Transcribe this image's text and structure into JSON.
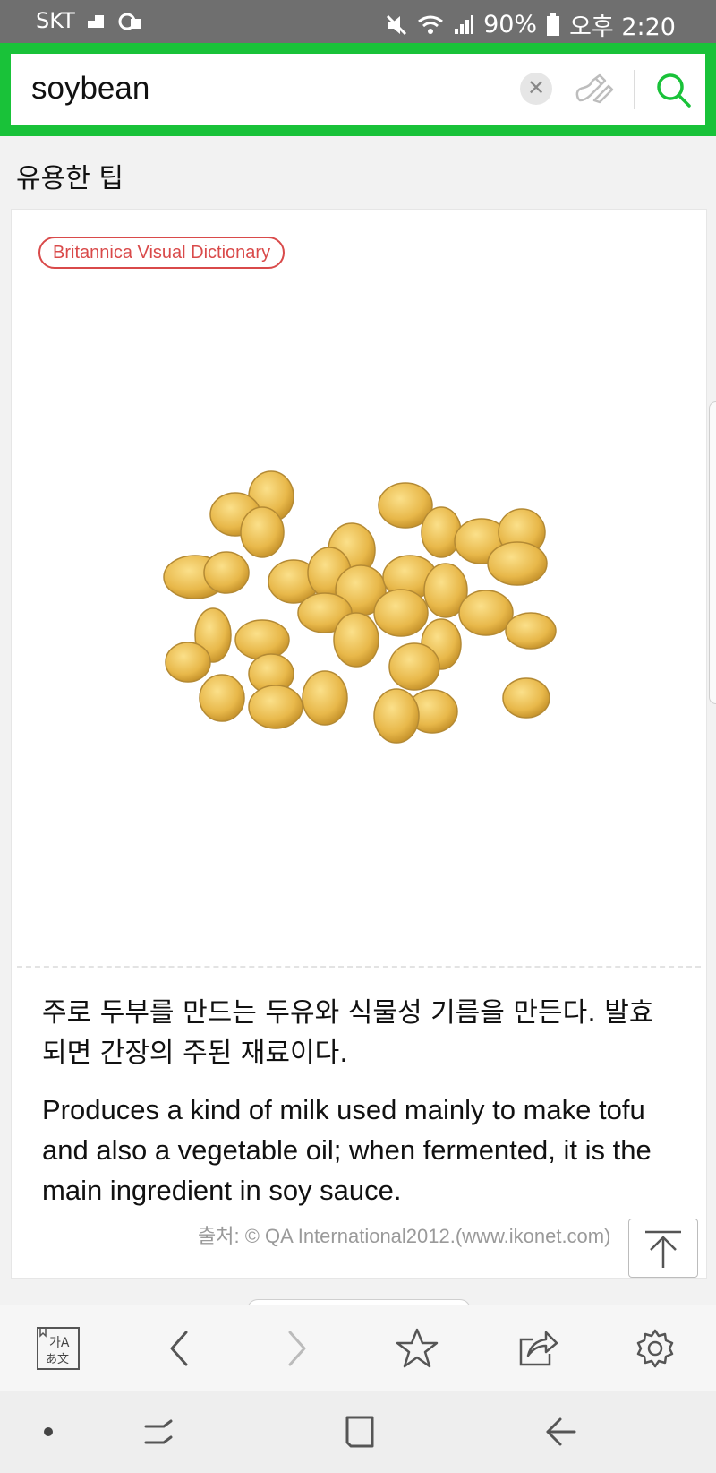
{
  "status_bar": {
    "carrier": "SKT",
    "battery": "90%",
    "time": "오후 2:20",
    "icons": [
      "sim-icon",
      "cloud-icon",
      "mute-icon",
      "wifi-icon",
      "signal-icon",
      "battery-icon"
    ]
  },
  "search": {
    "query": "soybean",
    "clear_icon": "close-icon",
    "handwrite_icon": "handwriting-icon",
    "search_icon": "search-icon"
  },
  "section": {
    "title": "유용한 팁"
  },
  "card": {
    "source": "Britannica Visual Dictionary",
    "illustration": "soybeans-illustration",
    "definition_ko": "주로 두부를 만드는 두유와 식물성 기름을 만든다. 발효되면 간장의 주된 재료이다.",
    "definition_en": "Produces a kind of milk used mainly to make tofu and also a vegetable oil; when fermented, it is the main ingredient in soy sauce.",
    "credit": "출처: © QA International2012.(www.ikonet.com)"
  },
  "toolbar": {
    "items": [
      "translate-icon",
      "back-icon",
      "forward-icon",
      "star-icon",
      "share-icon",
      "settings-icon"
    ]
  },
  "navbar": {
    "items": [
      "dot-icon",
      "recent-apps-icon",
      "home-icon",
      "back-icon"
    ]
  },
  "colors": {
    "accent": "#19c239",
    "badge": "#d94a4a",
    "bean": "#e8b84a"
  }
}
